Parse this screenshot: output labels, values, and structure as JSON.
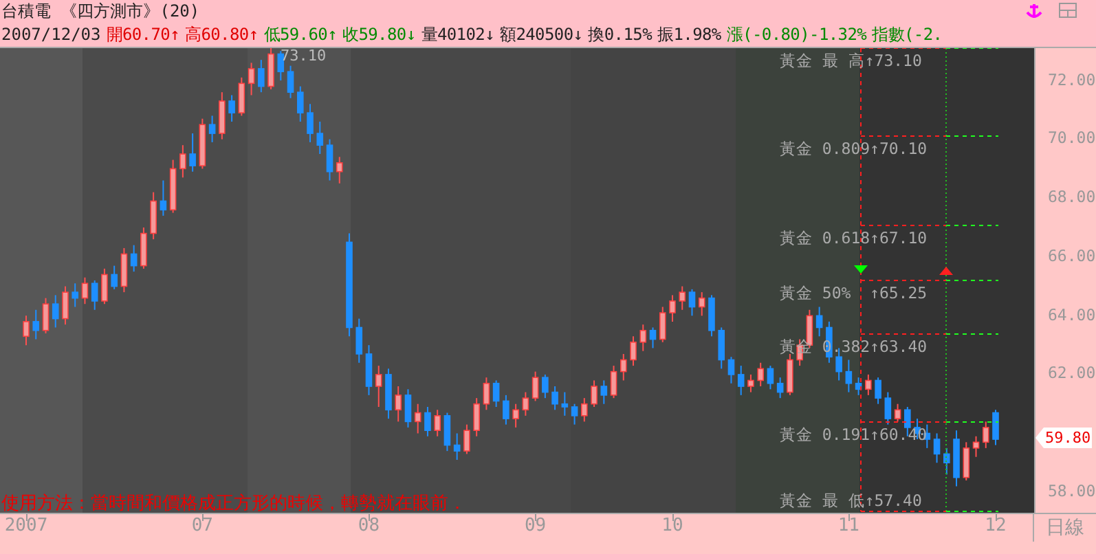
{
  "header": {
    "title": "台積電 《四方測市》(20)",
    "date": "2007/12/03",
    "quotes": [
      {
        "text": "開60.70↑",
        "color": "#e00000"
      },
      {
        "text": "高60.80↑",
        "color": "#e00000"
      },
      {
        "text": "低59.60↑",
        "color": "#008a00"
      },
      {
        "text": "收59.80↓",
        "color": "#008a00"
      },
      {
        "text": "量40102↓",
        "color": "#222222"
      },
      {
        "text": "額240500↓",
        "color": "#222222"
      },
      {
        "text": "換0.15%",
        "color": "#222222"
      },
      {
        "text": "振1.98%",
        "color": "#222222"
      },
      {
        "text": "漲(-0.80)-1.32%",
        "color": "#008a00"
      },
      {
        "text": "指數(-2.",
        "color": "#008a00"
      }
    ]
  },
  "chart": {
    "peak_label": "73.10",
    "golden_levels": [
      "黃金 最 高↑73.10",
      "黃金 0.809↑70.10",
      "黃金 0.618↑67.10",
      "黃金 50%  ↑65.25",
      "黃金 0.382↑63.40",
      "黃金 0.191↑60.40",
      "黃金 最 低↑57.40"
    ],
    "note": "使用方法：當時間和價格成正方形的時候，轉勢就在眼前．",
    "last_price": "59.80",
    "period": "日線",
    "chart_data": {
      "type": "candlestick",
      "ylim": [
        57.3,
        73.1
      ],
      "yticks": [
        {
          "value": 72,
          "label": "72.00"
        },
        {
          "value": 70,
          "label": "70.00"
        },
        {
          "value": 68,
          "label": "68.00"
        },
        {
          "value": 66,
          "label": "66.00"
        },
        {
          "value": 64,
          "label": "64.00"
        },
        {
          "value": 62,
          "label": "62.00"
        },
        {
          "value": 58,
          "label": "58.00"
        }
      ],
      "categories": [
        "2007",
        null,
        null,
        null,
        null,
        null,
        null,
        null,
        null,
        null,
        null,
        null,
        null,
        null,
        null,
        null,
        null,
        null,
        "07",
        null,
        null,
        null,
        null,
        null,
        null,
        null,
        null,
        null,
        null,
        null,
        null,
        null,
        null,
        null,
        null,
        "08",
        null,
        null,
        null,
        null,
        null,
        null,
        null,
        null,
        null,
        null,
        null,
        null,
        null,
        null,
        null,
        null,
        "09",
        null,
        null,
        null,
        null,
        null,
        null,
        null,
        null,
        null,
        null,
        null,
        null,
        null,
        "10",
        null,
        null,
        null,
        null,
        null,
        null,
        null,
        null,
        null,
        null,
        null,
        null,
        null,
        null,
        null,
        null,
        null,
        "11",
        null,
        null,
        null,
        null,
        null,
        null,
        null,
        null,
        null,
        null,
        null,
        null,
        null,
        null,
        "12"
      ],
      "ohlc": [
        [
          63.3,
          64.0,
          63.0,
          63.8
        ],
        [
          63.8,
          64.2,
          63.2,
          63.5
        ],
        [
          63.5,
          64.6,
          63.4,
          64.4
        ],
        [
          64.4,
          64.7,
          63.6,
          63.9
        ],
        [
          63.9,
          65.0,
          63.7,
          64.8
        ],
        [
          64.8,
          65.1,
          64.3,
          64.6
        ],
        [
          64.6,
          65.3,
          64.4,
          65.1
        ],
        [
          65.1,
          65.2,
          64.2,
          64.5
        ],
        [
          64.5,
          65.6,
          64.4,
          65.4
        ],
        [
          65.4,
          65.7,
          64.9,
          65.0
        ],
        [
          65.0,
          66.3,
          64.8,
          66.1
        ],
        [
          66.1,
          66.4,
          65.5,
          65.7
        ],
        [
          65.7,
          67.0,
          65.6,
          66.8
        ],
        [
          66.8,
          68.2,
          66.6,
          67.9
        ],
        [
          67.9,
          68.6,
          67.4,
          67.6
        ],
        [
          67.6,
          69.3,
          67.5,
          69.0
        ],
        [
          69.0,
          69.8,
          68.7,
          69.5
        ],
        [
          69.5,
          70.2,
          68.9,
          69.1
        ],
        [
          69.1,
          70.7,
          69.0,
          70.5
        ],
        [
          70.5,
          70.8,
          69.9,
          70.2
        ],
        [
          70.2,
          71.6,
          70.0,
          71.3
        ],
        [
          71.3,
          71.5,
          70.6,
          70.9
        ],
        [
          70.9,
          72.1,
          70.8,
          71.9
        ],
        [
          71.9,
          72.6,
          71.5,
          72.4
        ],
        [
          72.4,
          72.7,
          71.6,
          71.8
        ],
        [
          71.8,
          73.1,
          71.7,
          72.9
        ],
        [
          72.9,
          73.0,
          72.0,
          72.3
        ],
        [
          72.3,
          72.5,
          71.4,
          71.6
        ],
        [
          71.6,
          71.8,
          70.6,
          70.9
        ],
        [
          70.9,
          71.2,
          69.9,
          70.2
        ],
        [
          70.2,
          70.6,
          69.5,
          69.8
        ],
        [
          69.8,
          70.0,
          68.6,
          68.9
        ],
        [
          68.9,
          69.4,
          68.5,
          69.2
        ],
        [
          66.5,
          66.8,
          63.3,
          63.6
        ],
        [
          63.6,
          63.9,
          62.4,
          62.7
        ],
        [
          62.7,
          63.0,
          61.3,
          61.6
        ],
        [
          61.6,
          62.3,
          60.9,
          62.0
        ],
        [
          62.0,
          62.2,
          60.5,
          60.8
        ],
        [
          60.8,
          61.6,
          60.4,
          61.3
        ],
        [
          61.3,
          61.5,
          60.2,
          60.4
        ],
        [
          60.4,
          61.0,
          60.0,
          60.7
        ],
        [
          60.7,
          60.9,
          59.9,
          60.1
        ],
        [
          60.1,
          60.8,
          59.9,
          60.6
        ],
        [
          60.6,
          60.7,
          59.4,
          59.6
        ],
        [
          59.6,
          60.0,
          59.1,
          59.4
        ],
        [
          59.4,
          60.3,
          59.3,
          60.1
        ],
        [
          60.1,
          61.2,
          59.9,
          61.0
        ],
        [
          61.0,
          61.9,
          60.8,
          61.7
        ],
        [
          61.7,
          61.8,
          60.9,
          61.1
        ],
        [
          61.1,
          61.3,
          60.3,
          60.5
        ],
        [
          60.5,
          61.0,
          60.2,
          60.8
        ],
        [
          60.8,
          61.4,
          60.6,
          61.2
        ],
        [
          61.2,
          62.1,
          61.1,
          61.9
        ],
        [
          61.9,
          62.0,
          61.2,
          61.4
        ],
        [
          61.4,
          61.6,
          60.8,
          61.0
        ],
        [
          61.0,
          61.4,
          60.6,
          60.9
        ],
        [
          60.9,
          61.0,
          60.3,
          60.6
        ],
        [
          60.6,
          61.2,
          60.4,
          61.0
        ],
        [
          61.0,
          61.8,
          60.9,
          61.6
        ],
        [
          61.6,
          61.8,
          61.0,
          61.3
        ],
        [
          61.3,
          62.3,
          61.2,
          62.1
        ],
        [
          62.1,
          62.7,
          61.8,
          62.5
        ],
        [
          62.5,
          63.3,
          62.3,
          63.1
        ],
        [
          63.1,
          63.7,
          62.8,
          63.5
        ],
        [
          63.5,
          63.6,
          62.9,
          63.2
        ],
        [
          63.2,
          64.3,
          63.1,
          64.1
        ],
        [
          64.1,
          64.7,
          63.8,
          64.5
        ],
        [
          64.5,
          65.0,
          64.2,
          64.8
        ],
        [
          64.8,
          64.9,
          64.0,
          64.3
        ],
        [
          64.3,
          64.8,
          64.0,
          64.6
        ],
        [
          64.6,
          64.7,
          63.3,
          63.5
        ],
        [
          63.5,
          63.6,
          62.2,
          62.5
        ],
        [
          62.5,
          62.6,
          61.7,
          62.0
        ],
        [
          62.0,
          62.3,
          61.3,
          61.6
        ],
        [
          61.6,
          62.0,
          61.4,
          61.8
        ],
        [
          61.8,
          62.4,
          61.6,
          62.2
        ],
        [
          62.2,
          62.3,
          61.5,
          61.7
        ],
        [
          61.7,
          61.9,
          61.2,
          61.4
        ],
        [
          61.4,
          62.7,
          61.3,
          62.5
        ],
        [
          62.5,
          63.2,
          62.3,
          63.0
        ],
        [
          63.0,
          64.2,
          62.9,
          64.0
        ],
        [
          64.0,
          64.3,
          63.3,
          63.6
        ],
        [
          63.6,
          63.8,
          62.4,
          62.6
        ],
        [
          62.6,
          62.9,
          61.8,
          62.1
        ],
        [
          62.1,
          62.5,
          61.4,
          61.7
        ],
        [
          61.7,
          61.9,
          61.3,
          61.5
        ],
        [
          61.5,
          62.0,
          61.3,
          61.8
        ],
        [
          61.8,
          61.9,
          61.0,
          61.2
        ],
        [
          61.2,
          61.4,
          60.3,
          60.5
        ],
        [
          60.5,
          61.0,
          60.4,
          60.8
        ],
        [
          60.8,
          60.9,
          59.9,
          60.2
        ],
        [
          60.2,
          60.5,
          59.8,
          60.0
        ],
        [
          60.0,
          60.3,
          59.5,
          59.8
        ],
        [
          59.8,
          60.0,
          59.0,
          59.3
        ],
        [
          59.3,
          59.5,
          58.6,
          59.0
        ],
        [
          59.8,
          60.1,
          58.2,
          58.5
        ],
        [
          58.5,
          59.7,
          58.4,
          59.5
        ],
        [
          59.5,
          59.9,
          59.2,
          59.7
        ],
        [
          59.7,
          60.4,
          59.5,
          60.2
        ],
        [
          60.7,
          60.8,
          59.6,
          59.8
        ]
      ]
    }
  }
}
